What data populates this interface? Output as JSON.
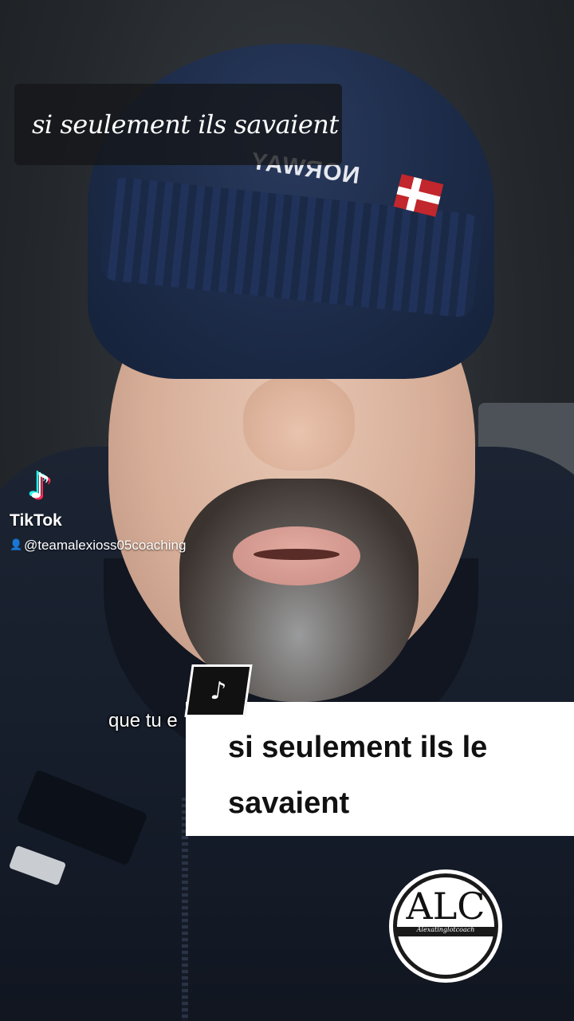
{
  "overlay": {
    "top_caption": "si seulement ils savaient",
    "subtitle_partial": "que tu e",
    "card_text": "si seulement ils le savaient"
  },
  "watermark": {
    "brand": "TikTok",
    "username": "@teamalexioss05coaching",
    "icon": "tiktok-note-icon",
    "user_icon": "person-icon"
  },
  "video": {
    "hat_text": "NORWAY",
    "hat_logo": "geographical-norway-logo"
  },
  "logo": {
    "letters": "ALC",
    "script": "Alexatinglotcoach"
  },
  "colors": {
    "tiktok_cyan": "#25f4ee",
    "tiktok_red": "#fe2c55",
    "card_bg": "#ffffff",
    "card_text": "#111111"
  }
}
